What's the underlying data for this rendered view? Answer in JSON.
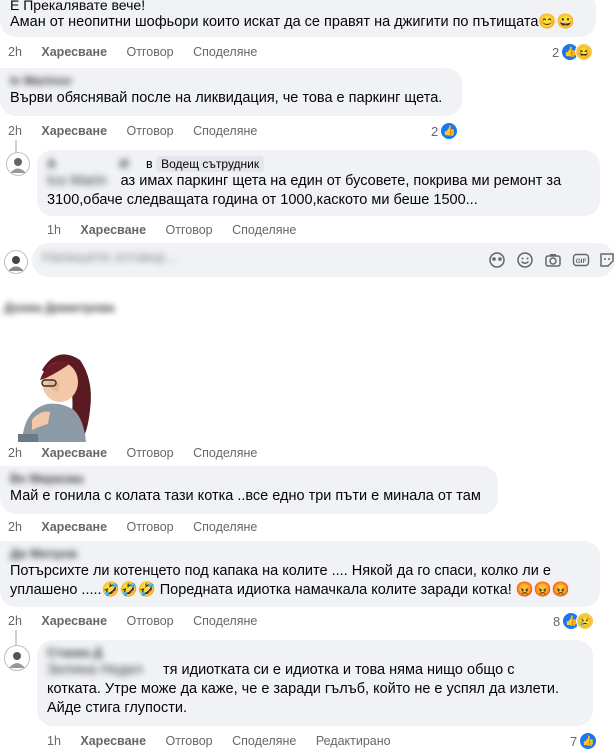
{
  "actions": {
    "like": "Харесване",
    "reply": "Отговор",
    "share": "Споделяне",
    "edited": "Редактирано"
  },
  "comments": [
    {
      "author": "Е Прекалявате вече!",
      "text": "Аман от неопитни шофьори които искат да се правят на джигити по пътищата😊😀",
      "time": "2h",
      "reactions": "2"
    },
    {
      "author": "Iv Marinov",
      "text": "Върви обяснявай после на ликвидация, че това е паркинг щета.",
      "time": "2h",
      "reactions": "2"
    },
    {
      "author": "А",
      "author_tail": "И",
      "in": "в",
      "badge": "Водещ сътрудник",
      "mention": "Ico Marin",
      "text": "аз имах паркинг щета на един от бусовете, покрива ми ремонт за 3100,обаче следващата година от 1000,каското ми беше 1500...",
      "time": "1h"
    },
    {
      "author": "Донка Димитрова",
      "time": "2h"
    },
    {
      "author": "Ве Миркова",
      "text": "Май е гонила с колата тази котка ..все едно три пъти е минала от там",
      "time": "2h"
    },
    {
      "author": "Ди Митров",
      "text": "Потърсихте ли котенцето под капака на колите .... Някой да го спаси, колко ли е уплашено .....🤣🤣🤣 Поредната идиотка намачкала колите заради котка! 😡😡😡",
      "time": "2h",
      "reactions": "8"
    },
    {
      "author": "Станка Д",
      "mention": "Зиляна Недел",
      "text_line1": "тя идиотката си е идиотка и това няма нищо общо с",
      "text_rest": "котката. Утре може да каже, че е заради гълъб, който не е успял да излети. Айде стига глупости.",
      "time": "1h",
      "reactions": "7"
    }
  ],
  "composer": {
    "placeholder": "Напишете отговор...",
    "icons": [
      "stickers-icon",
      "emoji-icon",
      "camera-icon",
      "gif-icon",
      "sticker-icon"
    ]
  }
}
